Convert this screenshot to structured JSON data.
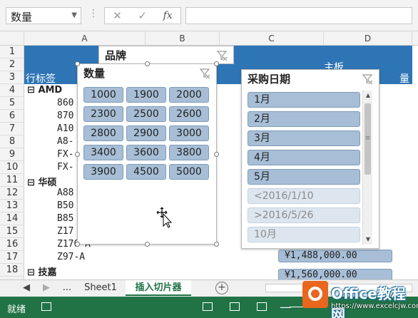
{
  "formula_bar": {
    "name_box": "数量",
    "cancel_symbol": "✕",
    "enter_symbol": "✓",
    "fx_label": "fx",
    "formula": ""
  },
  "columns": [
    "A",
    "B",
    "C",
    "D"
  ],
  "rows": [
    "1",
    "2",
    "3",
    "4",
    "5",
    "6",
    "7",
    "8",
    "9",
    "10",
    "11",
    "12",
    "13",
    "14",
    "15",
    "16",
    "17",
    "18"
  ],
  "sheet": {
    "header_label": "主板",
    "row_label_header": "行标签",
    "partial_right_header": "量",
    "groups": [
      {
        "label": "AMD",
        "collapse": "⊟"
      },
      {
        "label": "华硕",
        "collapse": "⊟"
      },
      {
        "label": "技嘉",
        "collapse": "⊟"
      }
    ],
    "row_items": [
      "860",
      "870",
      "A10",
      "A8-",
      "FX-",
      "FX-",
      "A88",
      "B50",
      "B85",
      "Z17",
      "Z170-A",
      "Z97-A"
    ],
    "value_cells": [
      "¥1,488,000.00",
      "¥1,560,000.00"
    ]
  },
  "slicers": {
    "brand": {
      "title": "品牌"
    },
    "quantity": {
      "title": "数量",
      "items": [
        "1000",
        "1900",
        "2000",
        "2300",
        "2500",
        "2600",
        "2800",
        "2900",
        "3000",
        "3400",
        "3600",
        "3800",
        "3900",
        "4500",
        "5000"
      ]
    },
    "purchase_date": {
      "title": "采购日期",
      "items": [
        "1月",
        "2月",
        "3月",
        "4月",
        "5月"
      ],
      "nodata_items": [
        "<2016/1/10",
        ">2016/5/26",
        "10月"
      ],
      "scroll_up": "▲",
      "scroll_down": "▼",
      "scroll_grip": "≡"
    }
  },
  "tabs": {
    "nav_prev": "◀",
    "nav_next": "▶",
    "more": "...",
    "sheet1": "Sheet1",
    "active": "插入切片器",
    "add_symbol": "+"
  },
  "status": {
    "text": "就绪",
    "zoom_minus": "—"
  },
  "watermark": {
    "title": "Office教程网",
    "url": "https://www.excelcjw.com"
  },
  "colors": {
    "accent_green": "#217346",
    "pivot_header_blue": "#2e75b6",
    "slicer_item": "#a7bed6",
    "watermark_orange": "#e8661d"
  }
}
